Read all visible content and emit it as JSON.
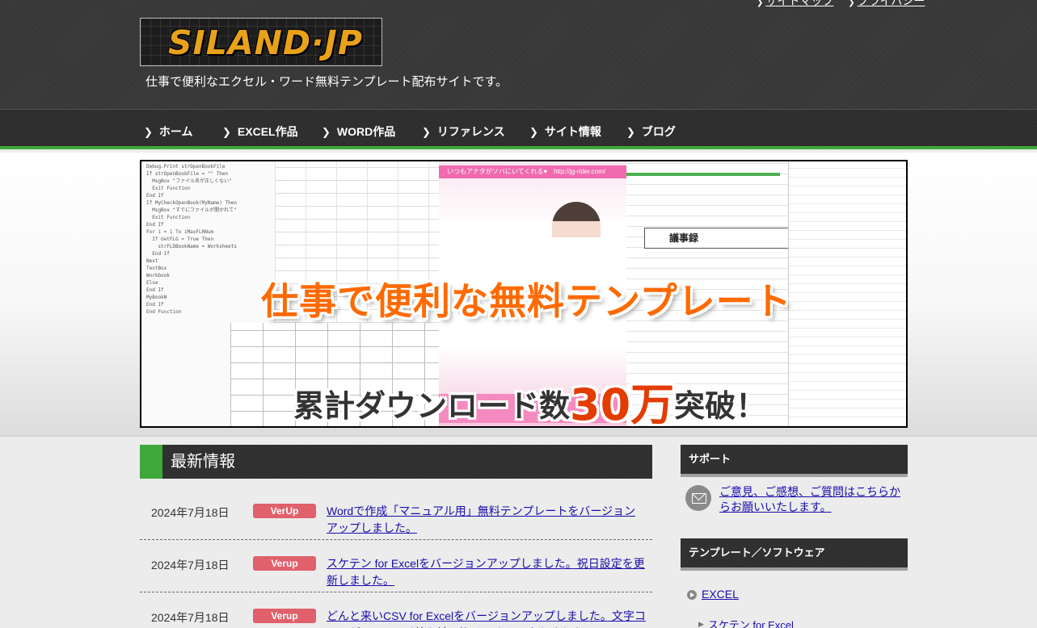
{
  "header": {
    "top_links": [
      "サイトマップ",
      "プライバシー"
    ],
    "logo_text": "SILAND·JP",
    "tagline": "仕事で便利なエクセル・ワード無料テンプレート配布サイトです。"
  },
  "nav": {
    "items": [
      "ホーム",
      "EXCEL作品",
      "WORD作品",
      "リファレンス",
      "サイト情報",
      "ブログ"
    ]
  },
  "hero": {
    "headline": "仕事で便利な無料テンプレート",
    "sub_prefix": "累計ダウンロード数",
    "sub_number": "30万",
    "sub_suffix": "突破！",
    "flyer_banner": "いつもアナタがソバにいてくれる♥　http://jg-rider.com/",
    "doc_label": "議事録"
  },
  "main": {
    "section_title": "最新情報",
    "news": [
      {
        "date": "2024年7月18日",
        "badge": "VerUp",
        "text": "Wordで作成「マニュアル用」無料テンプレートをバージョンアップしました。"
      },
      {
        "date": "2024年7月18日",
        "badge": "Verup",
        "text": "スケテン for Excelをバージョンアップしました。祝日設定を更新しました。"
      },
      {
        "date": "2024年7月18日",
        "badge": "Verup",
        "text": "どんと来いCSV for Excelをバージョンアップしました。文字コードがShift-JIS以外も読み込めるようになりました。"
      }
    ]
  },
  "sidebar": {
    "support_title": "サポート",
    "support_link": "ご意見、ご感想、ご質問はこちらからお願いいたします。",
    "templates_title": "テンプレート／ソフトウェア",
    "category": "EXCEL",
    "sub_item": "スケテン for Excel"
  },
  "colors": {
    "accent_green": "#3ea83a",
    "badge_red": "#e0606b",
    "hero_orange": "#ff6a00",
    "link_blue": "#1a0dab"
  }
}
